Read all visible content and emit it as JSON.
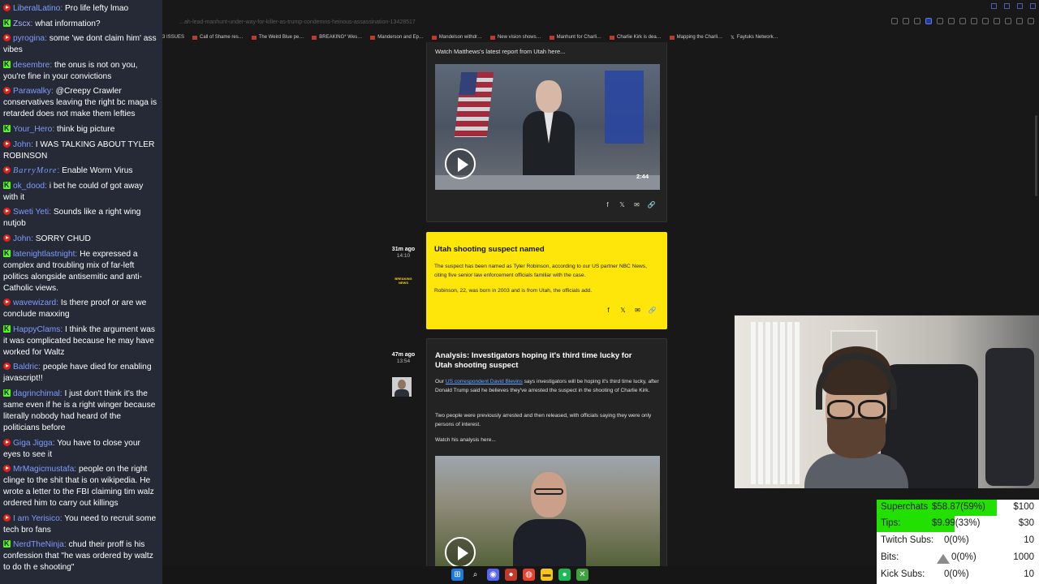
{
  "chat": {
    "messages": [
      {
        "platform": "yt",
        "user": "LiberalLatino",
        "user_color": "#7fa0ff",
        "text": "Pro life lefty lmao"
      },
      {
        "platform": "kk",
        "user": "Zscx",
        "user_color": "#b0b0ff",
        "text": "what information?"
      },
      {
        "platform": "yt",
        "user": "pyrogina",
        "user_color": "#7f9bff",
        "text": "some 'we dont claim him' ass vibes"
      },
      {
        "platform": "kk",
        "user": "desembre",
        "user_color": "#7f9bff",
        "text": "the onus is not on you, you're fine in your convictions"
      },
      {
        "platform": "yt",
        "user": "Parawalky",
        "user_color": "#7f9bff",
        "text": "@Creepy Crawler conservatives leaving the right bc maga is retarded does not make them lefties"
      },
      {
        "platform": "kk",
        "user": "Your_Hero",
        "user_color": "#7f9bff",
        "text": "think big picture"
      },
      {
        "platform": "yt",
        "user": "John",
        "user_color": "#7f9bff",
        "text": "I WAS TALKING ABOUT TYLER ROBINSON"
      },
      {
        "platform": "yt",
        "user": "BarryMore",
        "user_color": "#7f9bff",
        "text": "Enable Worm Virus",
        "italic": true
      },
      {
        "platform": "kk",
        "user": "ok_dood",
        "user_color": "#7f9bff",
        "text": "i bet he could of got away with it"
      },
      {
        "platform": "yt",
        "user": "Sweti Yeti",
        "user_color": "#7f9bff",
        "text": "Sounds like a right wing nutjob"
      },
      {
        "platform": "yt",
        "user": "John",
        "user_color": "#7f9bff",
        "text": "SORRY CHUD"
      },
      {
        "platform": "kk",
        "user": "latenightlastnight",
        "user_color": "#7f9bff",
        "text": "He expressed a complex and troubling mix of far-left politics alongside antisemitic and anti-Catholic views."
      },
      {
        "platform": "yt",
        "user": "wavewizard",
        "user_color": "#7f9bff",
        "text": "Is there proof or are we conclude maxxing"
      },
      {
        "platform": "kk",
        "user": "HappyClams",
        "user_color": "#7f9bff",
        "text": "I think the argument was it was complicated because he may have worked for Waltz"
      },
      {
        "platform": "yt",
        "user": "Baldric",
        "user_color": "#7f9bff",
        "text": "people have died for enabling javascript!!"
      },
      {
        "platform": "kk",
        "user": "dagrinchimal",
        "user_color": "#7f9bff",
        "text": "I just don't think it's the same even if he is a right winger because literally nobody had heard of the politicians before"
      },
      {
        "platform": "yt",
        "user": "Giga Jigga",
        "user_color": "#7f9bff",
        "text": "You have to close your eyes to see it"
      },
      {
        "platform": "yt",
        "user": "MrMagicmustafa",
        "user_color": "#7f9bff",
        "text": "people on the right clinge to the shit that is on wikipedia. He wrote a letter to the FBI claiming tim walz ordered him to carry out killings"
      },
      {
        "platform": "yt",
        "user": "I am Yerisico",
        "user_color": "#7f9bff",
        "text": "You need to recruit some tech bro fans"
      },
      {
        "platform": "kk",
        "user": "NerdTheNinja",
        "user_color": "#7f9bff",
        "text": "chud their proff is his confession that \"he was ordered by waltz to do th e shooting\""
      }
    ]
  },
  "browser": {
    "url": "…ah-lead-manhunt-under-way-for-killer-as-trump-condemns-heinous-assassination-13428517",
    "bookmarks": [
      "3 ISSUES",
      "Call of Shame res…",
      "The Weird Blue pe…",
      "BREAKING* Wes…",
      "Manderson and Ep…",
      "Mandelson withdr…",
      "New vision shows…",
      "Manhunt for Charli…",
      "Charlie Kirk is dea…",
      "Mapping the Charli…",
      "Faytuks Network…"
    ]
  },
  "article": {
    "post1": {
      "caption": "Watch Matthews's latest report from Utah here...",
      "duration": "2:44"
    },
    "post2": {
      "ago": "31m ago",
      "time": "14:10",
      "logo": "BREAKING NEWS",
      "headline": "Utah shooting suspect named",
      "body1": "The suspect has been named as Tyler Robinson, according to our US partner NBC News, citing five senior law enforcement officials familiar with the case.",
      "body2": "Robinson, 22, was born in 2003 and is from Utah, the officials add."
    },
    "post3": {
      "ago": "47m ago",
      "time": "13:54",
      "headline": "Analysis: Investigators hoping it's third time lucky for Utah shooting suspect",
      "p1_prefix": "Our ",
      "p1_link": "US correspondent David Blevins",
      "p1_suffix": " says investigators will be hoping it's third time lucky, after Donald Trump said he believes they've arrested the suspect in the shooting of Charlie Kirk.",
      "p2": "Two people were previously arrested and then released, with officials saying they were only persons of interest.",
      "p3": "Watch his analysis here..."
    }
  },
  "donations": {
    "superchats": {
      "label": "Superchats",
      "value": "$58.87(59%)",
      "goal": "$100",
      "progress": 0.59
    },
    "tips": {
      "label": "Tips:",
      "value": "$9.99(33%)",
      "goal": "$30",
      "progress": 0.33
    },
    "twitch": {
      "label": "Twitch Subs:",
      "value": "0(0%)",
      "goal": "10",
      "progress": 0
    },
    "bits": {
      "label": "Bits:",
      "value": "0(0%)",
      "goal": "1000",
      "progress": 0
    },
    "kick": {
      "label": "Kick Subs:",
      "value": "0(0%)",
      "goal": "10",
      "progress": 0
    }
  },
  "colors": {
    "breaking_yellow": "#ffe60a",
    "progress_green": "#22e000",
    "youtube_red": "#e62117",
    "kick_green": "#53fc18"
  },
  "taskbar": {
    "icons": [
      "windows-start-icon",
      "search-icon",
      "discord-icon",
      "app-icon",
      "chrome-icon",
      "file-explorer-icon",
      "spotify-icon",
      "xbox-icon"
    ]
  }
}
